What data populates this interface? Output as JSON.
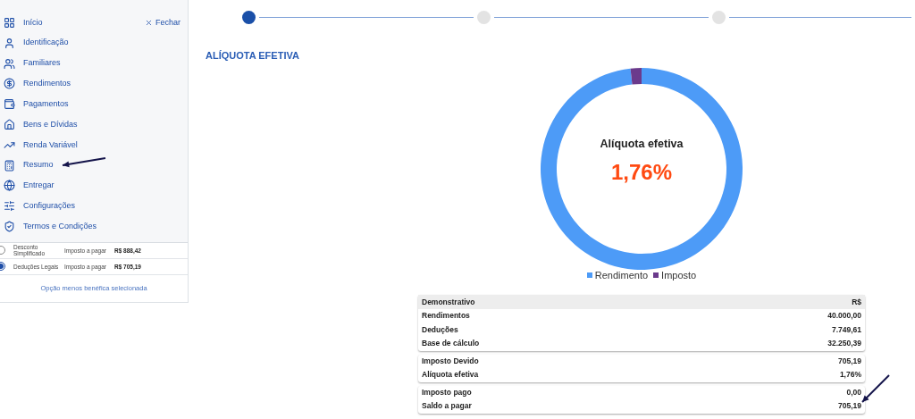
{
  "sidebar": {
    "close_label": "Fechar",
    "items": [
      {
        "label": "Início"
      },
      {
        "label": "Identificação"
      },
      {
        "label": "Familiares"
      },
      {
        "label": "Rendimentos"
      },
      {
        "label": "Pagamentos"
      },
      {
        "label": "Bens e Dívidas"
      },
      {
        "label": "Renda Variável"
      },
      {
        "label": "Resumo"
      },
      {
        "label": "Entregar"
      },
      {
        "label": "Configurações"
      },
      {
        "label": "Termos e Condições"
      }
    ],
    "options": [
      {
        "label": "Desconto Simplificado",
        "tax_label": "Imposto a pagar",
        "amount": "R$ 888,42",
        "selected": false
      },
      {
        "label": "Deduções Legais",
        "tax_label": "Imposto a pagar",
        "amount": "R$ 705,19",
        "selected": true
      }
    ],
    "note": "Opção menos benéfica selecionada"
  },
  "stepper": [
    {
      "selected": true
    },
    {
      "selected": false
    },
    {
      "selected": false
    }
  ],
  "section_title": "ALÍQUOTA EFETIVA",
  "donut": {
    "center_label": "Alíquota efetiva",
    "center_value": "1,76%",
    "chart_data": {
      "type": "donut",
      "categories": [
        "Rendimento",
        "Imposto"
      ],
      "values": [
        98.24,
        1.76
      ],
      "colors": [
        "#4d9bf7",
        "#6b3a8c"
      ]
    }
  },
  "table": {
    "header": {
      "label": "Demonstrativo",
      "value": "R$"
    },
    "groups": [
      [
        {
          "label": "Rendimentos",
          "value": "40.000,00"
        },
        {
          "label": "Deduções",
          "value": "7.749,61"
        },
        {
          "label": "Base de cálculo",
          "value": "32.250,39"
        }
      ],
      [
        {
          "label": "Imposto Devido",
          "value": "705,19"
        },
        {
          "label": "Alíquota efetiva",
          "value": "1,76%"
        }
      ],
      [
        {
          "label": "Imposto pago",
          "value": "0,00"
        },
        {
          "label": "Saldo a pagar",
          "value": "705,19"
        }
      ]
    ]
  }
}
